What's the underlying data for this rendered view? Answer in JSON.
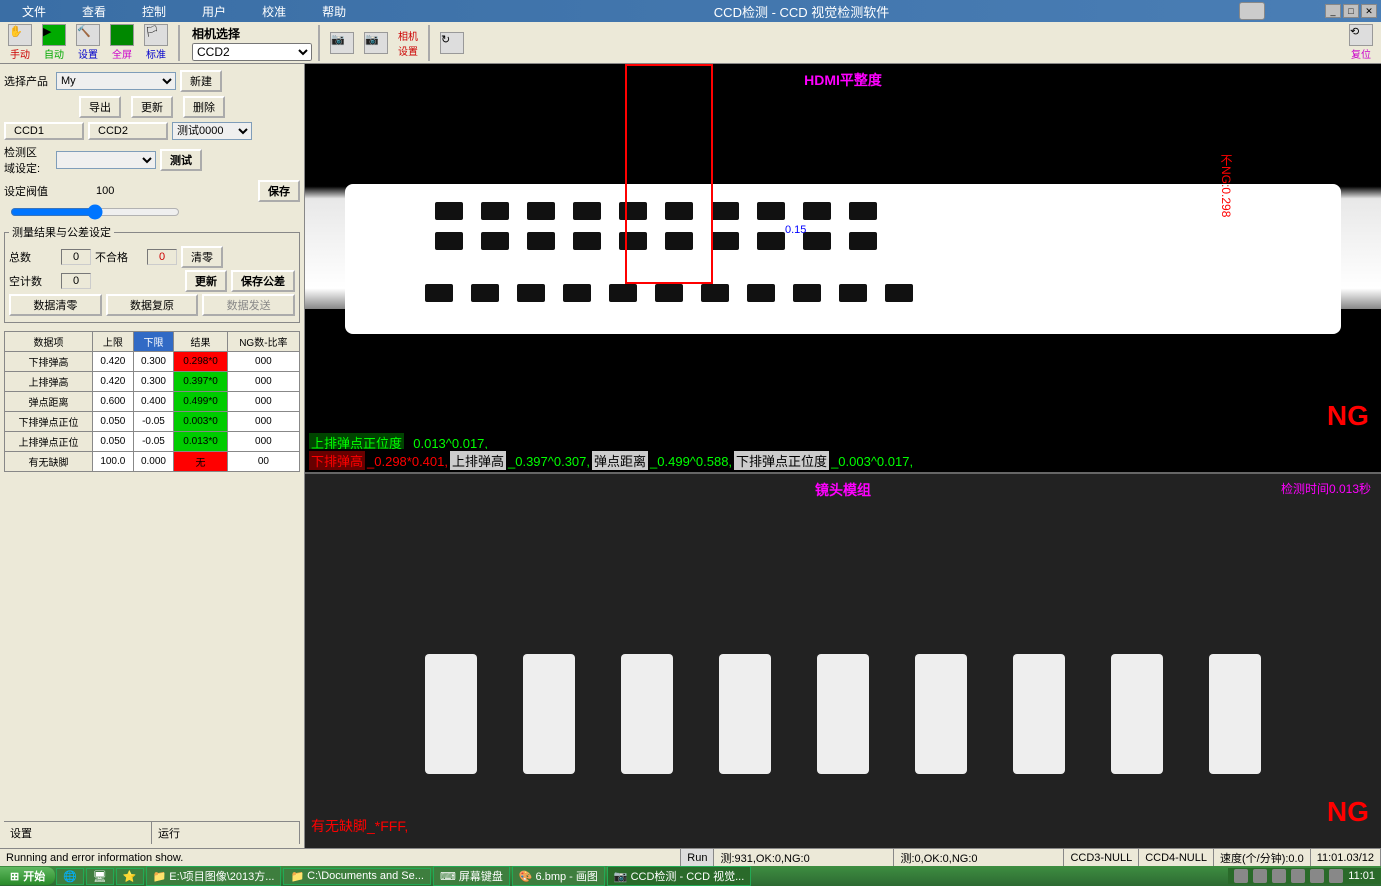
{
  "app": {
    "title_left": "CCD检测 - CCD 视觉检测软件"
  },
  "menu": [
    "文件",
    "查看",
    "控制",
    "用户",
    "校准",
    "帮助"
  ],
  "toolbar": {
    "items": [
      "手动",
      "自动",
      "设置",
      "全屏",
      "标准"
    ],
    "camera_select_label": "相机选择",
    "camera_select_val": "CCD2",
    "cam_set": "相机\n设置",
    "reset": "复位"
  },
  "product": {
    "label": "选择产品",
    "value": "My",
    "new": "新建",
    "export": "导出",
    "update": "更新",
    "delete": "删除",
    "ccd1": "CCD1",
    "ccd2": "CCD2",
    "test_sel": "测试0000",
    "roi_label": "检测区\n域设定:",
    "roi_val": "",
    "test_btn": "测试",
    "thresh_label": "设定阀值",
    "thresh_val": "100",
    "save": "保存"
  },
  "meas_panel": {
    "legend": "测量结果与公差设定",
    "total_lbl": "总数",
    "total": "0",
    "ng_lbl": "不合格",
    "ng": "0",
    "clear": "清零",
    "hole_lbl": "空计数",
    "hole": "0",
    "refresh": "更新",
    "savetol": "保存公差",
    "data_clear": "数据清零",
    "data_restore": "数据复原",
    "data_send": "数据发送"
  },
  "table": {
    "headers": [
      "数据项",
      "上限",
      "下限",
      "结果",
      "NG数-比率"
    ],
    "rows": [
      {
        "name": "下排弹高",
        "u": "0.420",
        "l": "0.300",
        "r": "0.298*0",
        "ng": "000",
        "cls": "red"
      },
      {
        "name": "上排弹高",
        "u": "0.420",
        "l": "0.300",
        "r": "0.397*0",
        "ng": "000",
        "cls": "grn"
      },
      {
        "name": "弹点距离",
        "u": "0.600",
        "l": "0.400",
        "r": "0.499*0",
        "ng": "000",
        "cls": "grn"
      },
      {
        "name": "下排弹点正位",
        "u": "0.050",
        "l": "-0.05",
        "r": "0.003*0",
        "ng": "000",
        "cls": "grn"
      },
      {
        "name": "上排弹点正位",
        "u": "0.050",
        "l": "-0.05",
        "r": "0.013*0",
        "ng": "000",
        "cls": "grn"
      },
      {
        "name": "有无缺脚",
        "u": "100.0",
        "l": "0.000",
        "r": "无",
        "ng": "00",
        "cls": "red"
      }
    ]
  },
  "view1": {
    "title": "HDMI平整度",
    "meas_val": "0.15",
    "vert": "不NG:0.298",
    "ng": "NG",
    "overlay_row1": [
      {
        "t": "上排弹点正位度",
        "cls": "grnbg"
      },
      {
        "t": "_0.013^0.017,",
        "cls": "green"
      }
    ],
    "overlay_row2": [
      {
        "t": "下排弹高",
        "cls": "redbg"
      },
      {
        "t": "_0.298*0.401,",
        "cls": "red"
      },
      {
        "t": "上排弹高",
        "cls": "white"
      },
      {
        "t": "_0.397^0.307,",
        "cls": "green"
      },
      {
        "t": "弹点距离",
        "cls": "white"
      },
      {
        "t": "_0.499^0.588,",
        "cls": "green"
      },
      {
        "t": "下排弹点正位度",
        "cls": "white"
      },
      {
        "t": "_0.003^0.017,",
        "cls": "green"
      }
    ]
  },
  "view2": {
    "title": "镜头模组",
    "time": "检测时间0.013秒",
    "bot_text": "有无缺脚_*FFF,",
    "ng": "NG"
  },
  "sidebar_bot": {
    "settings": "设置",
    "run": "运行"
  },
  "status": {
    "msg": "Running and error information show.",
    "run": "Run",
    "s1": "测:931,OK:0,NG:0",
    "s2": "测:0,OK:0,NG:0",
    "c3": "CCD3-NULL",
    "c4": "CCD4-NULL",
    "speed": "速度(个/分钟):0.0",
    "clock": "11:01.03/12"
  },
  "taskbar": {
    "start": "开始",
    "items": [
      "E:\\项目图像\\2013方...",
      "C:\\Documents and Se...",
      "屏幕键盘",
      "6.bmp - 画图",
      "CCD检测 - CCD 视觉..."
    ],
    "clock": "11:01"
  }
}
